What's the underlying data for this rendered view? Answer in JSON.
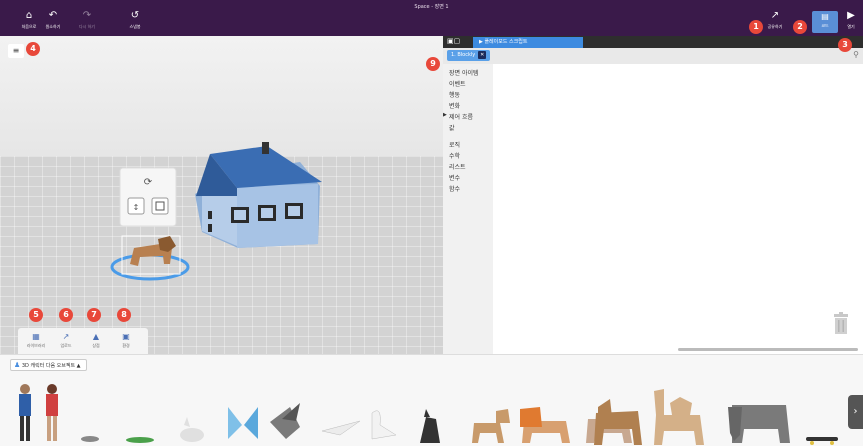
{
  "window": {
    "title": "Space - 장면 1"
  },
  "toolbar": {
    "home_label": "처음으로",
    "undo_label": "원소하기",
    "redo_label": "다시 하기",
    "snap_label": "스냅봉",
    "share_label": "공유하기",
    "code_label": "코드",
    "play_label": "열기"
  },
  "badges": [
    "1",
    "2",
    "3",
    "4",
    "5",
    "6",
    "7",
    "8",
    "9"
  ],
  "viewport": {
    "tabs": [
      {
        "label": "라이브러리",
        "icon": "grid-icon"
      },
      {
        "label": "업로드",
        "icon": "upload-icon"
      },
      {
        "label": "상점",
        "icon": "bag-icon"
      },
      {
        "label": "환경",
        "icon": "landscape-icon"
      }
    ]
  },
  "code_panel": {
    "script_tab": "플레이모드 스크립트",
    "blockly_tab": "1. Blockly",
    "categories": [
      "장면 아이템",
      "이벤트",
      "행동",
      "변화",
      "제어 흐름",
      "값",
      "",
      "로직",
      "수학",
      "리스트",
      "변수",
      "함수"
    ],
    "active_category": "제어 흐름"
  },
  "library": {
    "filter_label": "3D 캐릭터 다음 오브젝트",
    "items": [
      "man",
      "woman",
      "mouse",
      "lizard",
      "rabbit",
      "butterfly",
      "bird",
      "plane",
      "swan",
      "cat",
      "dog",
      "lion",
      "pig",
      "horse",
      "camel",
      "elephant",
      "skateboard"
    ]
  },
  "colors": {
    "toolbar": "#3a1a4a",
    "accent": "#3d8be0",
    "badge": "#e8483a",
    "house_roof": "#3a6db3",
    "house_wall": "#aac6e6"
  }
}
